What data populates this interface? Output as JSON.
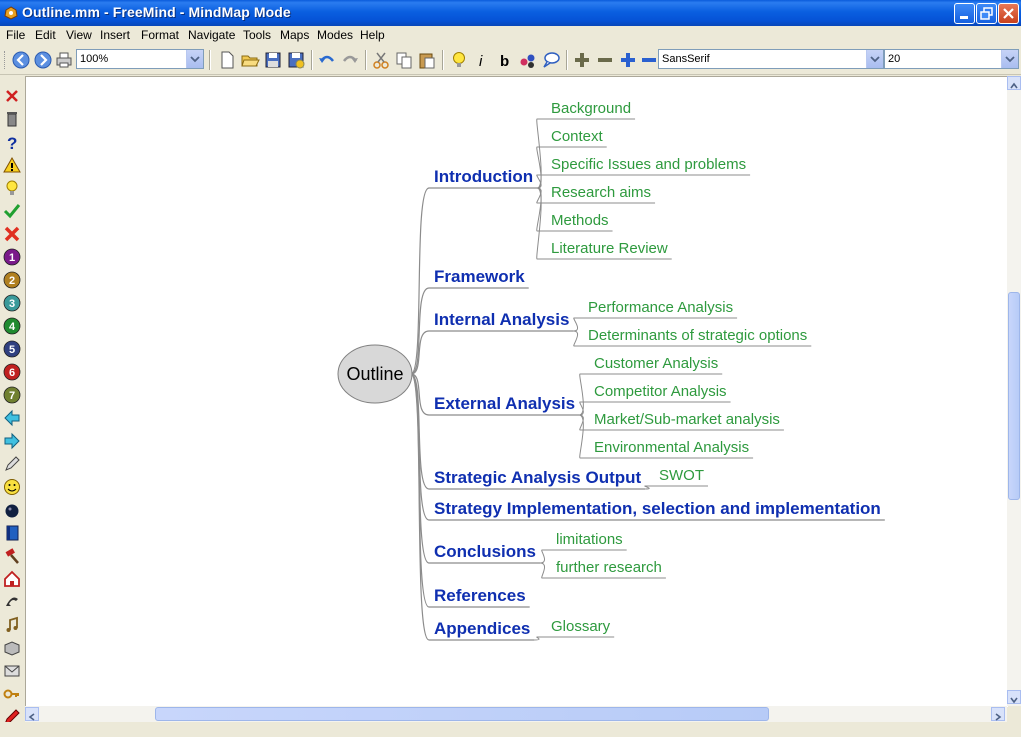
{
  "window": {
    "title": "Outline.mm - FreeMind - MindMap Mode"
  },
  "menu": [
    "File",
    "Edit",
    "View",
    "Insert",
    "Format",
    "Navigate",
    "Tools",
    "Maps",
    "Modes",
    "Help"
  ],
  "toolbar": {
    "zoom": "100%",
    "font_family": "SansSerif",
    "font_size": "20"
  },
  "colors": {
    "branch": "#0f2fb0",
    "leaf": "#2e9a3e",
    "edge": "#8c8c8c",
    "root_fill": "#d8d8d8"
  },
  "map": {
    "root": "Outline",
    "branches": [
      {
        "label": "Introduction",
        "children": [
          "Background",
          "Context",
          "Specific Issues and problems",
          "Research aims",
          "Methods",
          "Literature Review"
        ]
      },
      {
        "label": "Framework",
        "children": []
      },
      {
        "label": "Internal Analysis",
        "children": [
          "Performance Analysis",
          "Determinants of strategic options"
        ]
      },
      {
        "label": "External Analysis",
        "children": [
          "Customer Analysis",
          "Competitor Analysis",
          "Market/Sub-market analysis",
          "Environmental Analysis"
        ]
      },
      {
        "label": "Strategic Analysis Output",
        "children": [
          "SWOT"
        ]
      },
      {
        "label": "Strategy Implementation, selection and implementation",
        "children": []
      },
      {
        "label": "Conclusions",
        "children": [
          "limitations",
          "further research"
        ]
      },
      {
        "label": "References",
        "children": []
      },
      {
        "label": "Appendices",
        "children": [
          "Glossary"
        ]
      }
    ]
  },
  "left_icons": [
    "close-red-icon",
    "trash-icon",
    "question-icon",
    "warning-icon",
    "lightbulb-icon",
    "check-icon",
    "cross-icon",
    "number-1-icon",
    "number-2-icon",
    "number-3-icon",
    "number-4-icon",
    "number-5-icon",
    "number-6-icon",
    "number-7-icon",
    "arrow-left-icon",
    "arrow-right-icon",
    "pencil-icon",
    "smiley-icon",
    "bomb-icon",
    "book-icon",
    "hammer-icon",
    "home-icon",
    "phone-icon",
    "music-icon",
    "package-icon",
    "mail-icon",
    "key-icon",
    "marker-icon"
  ]
}
